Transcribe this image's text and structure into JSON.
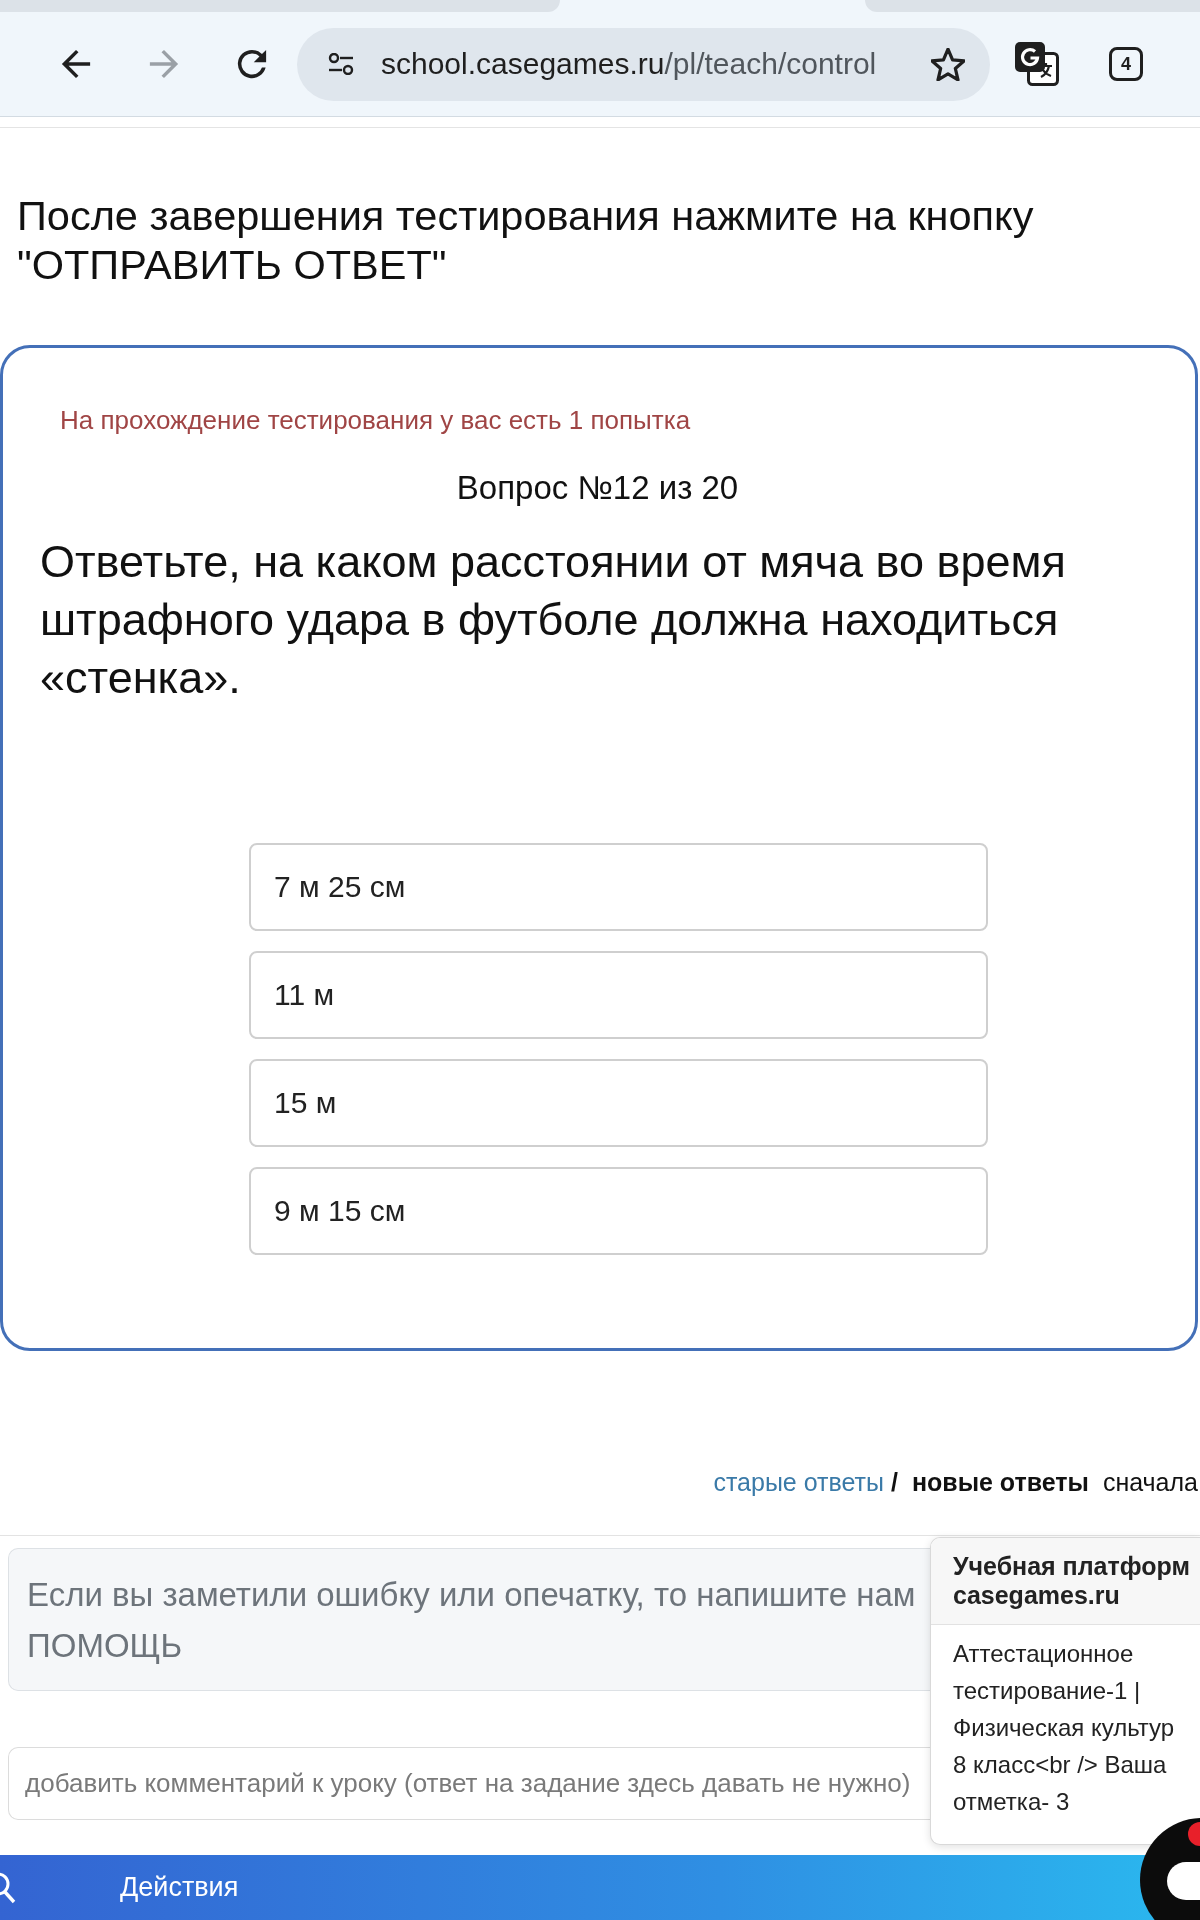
{
  "browser": {
    "nav_buttons": [
      {
        "kind": "back",
        "disabled": false
      },
      {
        "kind": "forward",
        "disabled": true
      },
      {
        "kind": "reload",
        "disabled": false
      }
    ],
    "url": {
      "host": "school.casegames.ru",
      "path": "/pl/teach/control"
    },
    "tab_count": "4"
  },
  "instruction": "После завершения тестирования нажмите на кнопку \"ОТПРАВИТЬ ОТВЕТ\"",
  "quiz": {
    "attempts_note": "На прохождение тестирования у вас есть 1 попытка",
    "progress": "Вопрос №12 из 20",
    "question": "Ответьте, на каком расстоянии от мяча во время штрафного удара в футболе должна находиться «стенка».",
    "options": [
      {
        "label": "7 м 25 см",
        "selected": false
      },
      {
        "label": "11 м",
        "selected": false
      },
      {
        "label": "15 м",
        "selected": false
      },
      {
        "label": "9 м 15 см",
        "selected": false
      }
    ]
  },
  "answers_sort": {
    "options": [
      {
        "label": "старые ответы",
        "selected": false
      },
      {
        "label": "новые ответы",
        "selected": true
      }
    ],
    "separator": "/",
    "suffix": "сначала"
  },
  "notice": {
    "lines": [
      "Если вы заметили ошибку или опечатку, то напишите нам",
      "ПОМОЩЬ"
    ]
  },
  "comment": {
    "placeholder": "добавить комментарий к уроку (ответ на задание здесь давать не нужно)"
  },
  "notification": {
    "title_lines": [
      "Учебная платформ",
      "casegames.ru"
    ],
    "body_lines": [
      "Аттестационное",
      "тестирование-1 |",
      "Физическая культур",
      "8 класс<br /> Ваша",
      "отметка- 3"
    ]
  },
  "bottom_bar": {
    "label": "Действия"
  },
  "chat_widget": {
    "unread": true
  }
}
